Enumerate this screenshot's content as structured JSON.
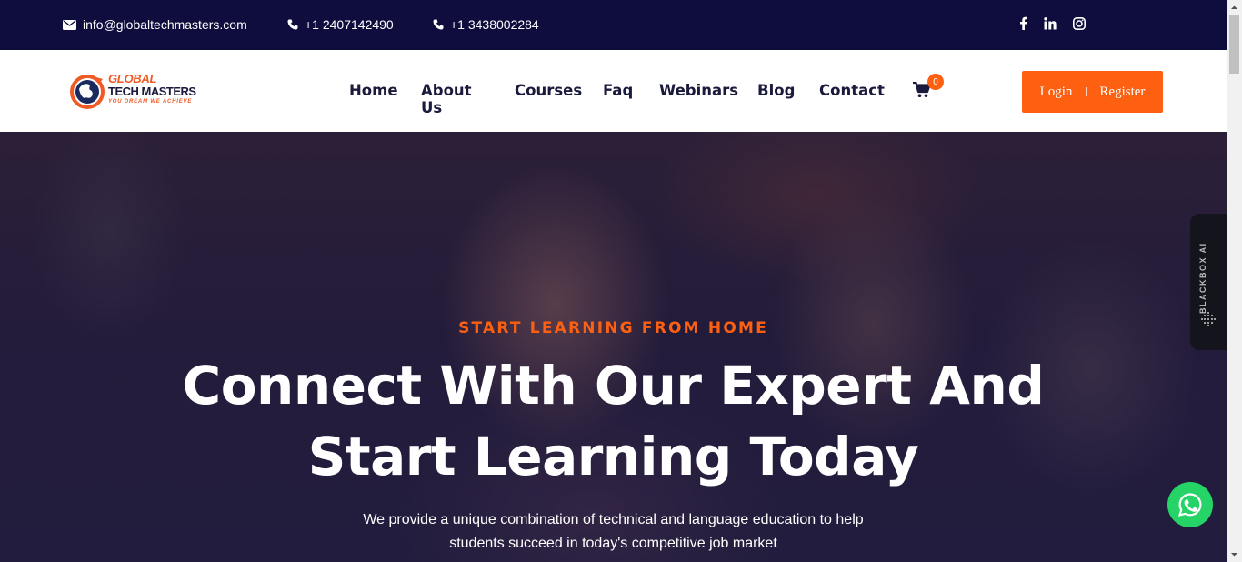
{
  "topbar": {
    "email": "info@globaltechmasters.com",
    "phone1": "+1 2407142490",
    "phone2": "+1 3438002284",
    "social": [
      "facebook-icon",
      "linkedin-icon",
      "instagram-icon"
    ]
  },
  "logo": {
    "line1": "GLOBAL",
    "line2": "TECH MASTERS",
    "tagline": "YOU DREAM WE ACHIEVE"
  },
  "nav": {
    "items": [
      {
        "label": "Home"
      },
      {
        "label": "About Us"
      },
      {
        "label": "Courses"
      },
      {
        "label": "Faq"
      },
      {
        "label": "Webinars"
      },
      {
        "label": "Blog"
      },
      {
        "label": "Contact"
      }
    ],
    "cart_count": "0",
    "login_label": "Login",
    "register_label": "Register"
  },
  "hero": {
    "eyebrow": "START LEARNING FROM HOME",
    "title_line1": "Connect With Our Expert And",
    "title_line2": "Start Learning Today",
    "desc_line1": "We provide a unique combination of technical and language education to help",
    "desc_line2": "students succeed in today's competitive job market"
  },
  "widgets": {
    "blackbox_label": "BLACKBOX AI"
  },
  "colors": {
    "topbar_bg": "#0f0c3e",
    "accent": "#fe6012",
    "whatsapp": "#25d366"
  }
}
